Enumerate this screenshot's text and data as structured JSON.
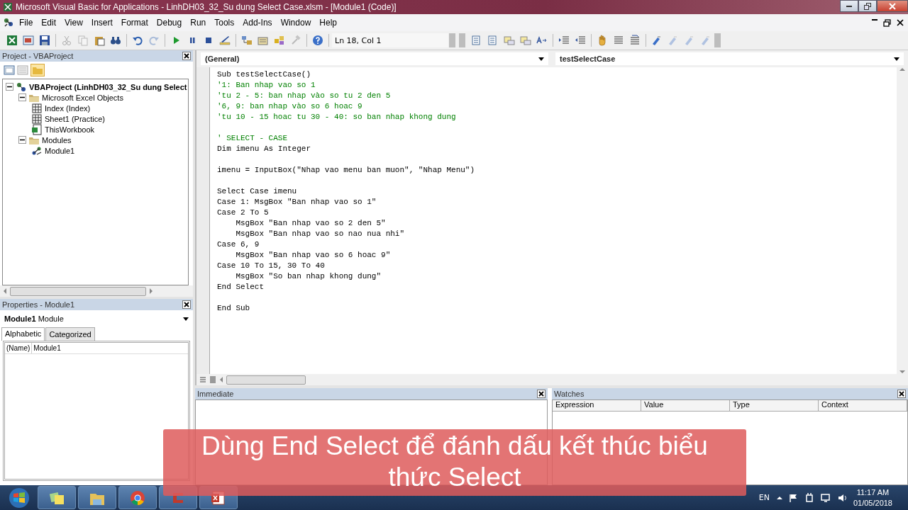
{
  "window": {
    "title": "Microsoft Visual Basic for Applications - LinhDH03_32_Su dung Select Case.xlsm - [Module1 (Code)]"
  },
  "menu": [
    "File",
    "Edit",
    "View",
    "Insert",
    "Format",
    "Debug",
    "Run",
    "Tools",
    "Add-Ins",
    "Window",
    "Help"
  ],
  "toolbar": {
    "buttons": [
      {
        "kind": "excel",
        "disabled": false
      },
      {
        "kind": "insert",
        "disabled": false
      },
      {
        "kind": "save",
        "disabled": false
      },
      {
        "kind": "sep"
      },
      {
        "kind": "cut",
        "disabled": true
      },
      {
        "kind": "copy",
        "disabled": true
      },
      {
        "kind": "paste",
        "disabled": false
      },
      {
        "kind": "find",
        "disabled": false
      },
      {
        "kind": "sep"
      },
      {
        "kind": "undo",
        "disabled": false
      },
      {
        "kind": "redo",
        "disabled": true
      },
      {
        "kind": "sep"
      },
      {
        "kind": "run",
        "disabled": false
      },
      {
        "kind": "pause",
        "disabled": false
      },
      {
        "kind": "stop",
        "disabled": false
      },
      {
        "kind": "design",
        "disabled": false
      },
      {
        "kind": "sep"
      },
      {
        "kind": "explorer",
        "disabled": false
      },
      {
        "kind": "properties",
        "disabled": false
      },
      {
        "kind": "browser",
        "disabled": false
      },
      {
        "kind": "toolbox",
        "disabled": true
      },
      {
        "kind": "sep"
      },
      {
        "kind": "help",
        "disabled": false
      }
    ],
    "position": "Ln 18, Col 1",
    "edit_buttons": [
      {
        "kind": "list",
        "disabled": false
      },
      {
        "kind": "list",
        "disabled": false
      },
      {
        "kind": "info",
        "disabled": false
      },
      {
        "kind": "info",
        "disabled": false
      },
      {
        "kind": "word",
        "disabled": false
      },
      {
        "kind": "sep"
      },
      {
        "kind": "indent",
        "disabled": false
      },
      {
        "kind": "outdent",
        "disabled": false
      },
      {
        "kind": "sep"
      },
      {
        "kind": "hand",
        "disabled": false
      },
      {
        "kind": "comment",
        "disabled": false
      },
      {
        "kind": "uncomment",
        "disabled": false
      },
      {
        "kind": "sep"
      },
      {
        "kind": "bookmark",
        "disabled": false
      },
      {
        "kind": "bookmark",
        "disabled": true
      },
      {
        "kind": "bookmark",
        "disabled": true
      },
      {
        "kind": "bookmark",
        "disabled": true
      }
    ]
  },
  "project": {
    "title": "Project - VBAProject",
    "tree": [
      {
        "label": "VBAProject (LinhDH03_32_Su dung Select",
        "kind": "project",
        "expanded": true,
        "children": [
          {
            "label": "Microsoft Excel Objects",
            "kind": "folder",
            "expanded": true,
            "children": [
              {
                "label": "Index (Index)",
                "kind": "sheet"
              },
              {
                "label": "Sheet1 (Practice)",
                "kind": "sheet"
              },
              {
                "label": "ThisWorkbook",
                "kind": "workbook"
              }
            ]
          },
          {
            "label": "Modules",
            "kind": "folder",
            "expanded": true,
            "children": [
              {
                "label": "Module1",
                "kind": "module"
              }
            ]
          }
        ]
      }
    ]
  },
  "properties": {
    "title": "Properties - Module1",
    "object": "**Module1** Module",
    "tabs": [
      {
        "label": "Alphabetic",
        "selected": true
      },
      {
        "label": "Categorized",
        "selected": false
      }
    ],
    "rows": [
      {
        "name": "(Name)",
        "value": "Module1"
      }
    ]
  },
  "code": {
    "object": "(General)",
    "procedure": "testSelectCase",
    "lines": [
      {
        "kind": "code",
        "text": "Sub testSelectCase()"
      },
      {
        "kind": "comment",
        "text": "'1: Ban nhap vao so 1"
      },
      {
        "kind": "comment",
        "text": "'tu 2 - 5: ban nhap vào so tu 2 den 5"
      },
      {
        "kind": "comment",
        "text": "'6, 9: ban nhap vào so 6 hoac 9"
      },
      {
        "kind": "comment",
        "text": "'tu 10 - 15 hoac tu 30 - 40: so ban nhap khong dung"
      },
      {
        "kind": "blank"
      },
      {
        "kind": "comment",
        "text": "' SELECT - CASE"
      },
      {
        "kind": "code",
        "text": "Dim imenu As Integer"
      },
      {
        "kind": "blank"
      },
      {
        "kind": "code",
        "text": "imenu = InputBox(\"Nhap vao menu ban muon\", \"Nhap Menu\")"
      },
      {
        "kind": "blank"
      },
      {
        "kind": "code",
        "text": "Select Case imenu"
      },
      {
        "kind": "code",
        "text": "Case 1: MsgBox \"Ban nhap vao so 1\""
      },
      {
        "kind": "code",
        "text": "Case 2 To 5"
      },
      {
        "kind": "code",
        "text": "    MsgBox \"Ban nhap vao so 2 den 5\""
      },
      {
        "kind": "code",
        "text": "    MsgBox \"Ban nhap vao so nao nua nhi\""
      },
      {
        "kind": "code",
        "text": "Case 6, 9"
      },
      {
        "kind": "code",
        "text": "    MsgBox \"Ban nhap vao so 6 hoac 9\""
      },
      {
        "kind": "code",
        "text": "Case 10 To 15, 30 To 40"
      },
      {
        "kind": "code",
        "text": "    MsgBox \"So ban nhap khong dung\""
      },
      {
        "kind": "code",
        "text": "End Select"
      },
      {
        "kind": "blank"
      },
      {
        "kind": "code",
        "text": "End Sub"
      }
    ]
  },
  "immediate": {
    "title": "Immediate"
  },
  "watches": {
    "title": "Watches",
    "columns": [
      "Expression",
      "Value",
      "Type",
      "Context"
    ]
  },
  "taskbar": {
    "apps": [
      {
        "kind": "notes"
      },
      {
        "kind": "folder"
      },
      {
        "kind": "chrome"
      },
      {
        "kind": "recorder"
      },
      {
        "kind": "excel"
      }
    ],
    "language": "EN",
    "time": "11:17 AM",
    "date": "01/05/2018"
  },
  "caption": "Dùng End Select để đánh dấu kết thúc biểu thức Select"
}
